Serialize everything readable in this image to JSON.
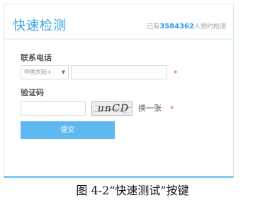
{
  "form": {
    "title": "快速检测",
    "reserve_prefix": "已有",
    "reserve_count": "3584362",
    "reserve_suffix": "人预约检测",
    "phone_label": "联系电话",
    "region_value": "中国大陆+",
    "region_icon": "chevron-down-icon",
    "phone_value": "",
    "required_mark": "*",
    "captcha_label": "验证码",
    "captcha_value": "",
    "captcha_text": "unCD",
    "refresh_captcha": "换一张",
    "submit_label": "提交"
  },
  "caption": "图 4-2“快速测试”按键",
  "colors": {
    "accent": "#3aa2e6",
    "button": "#5fb8f1",
    "required": "#e84b4b",
    "card_border": "#84c9f2"
  }
}
